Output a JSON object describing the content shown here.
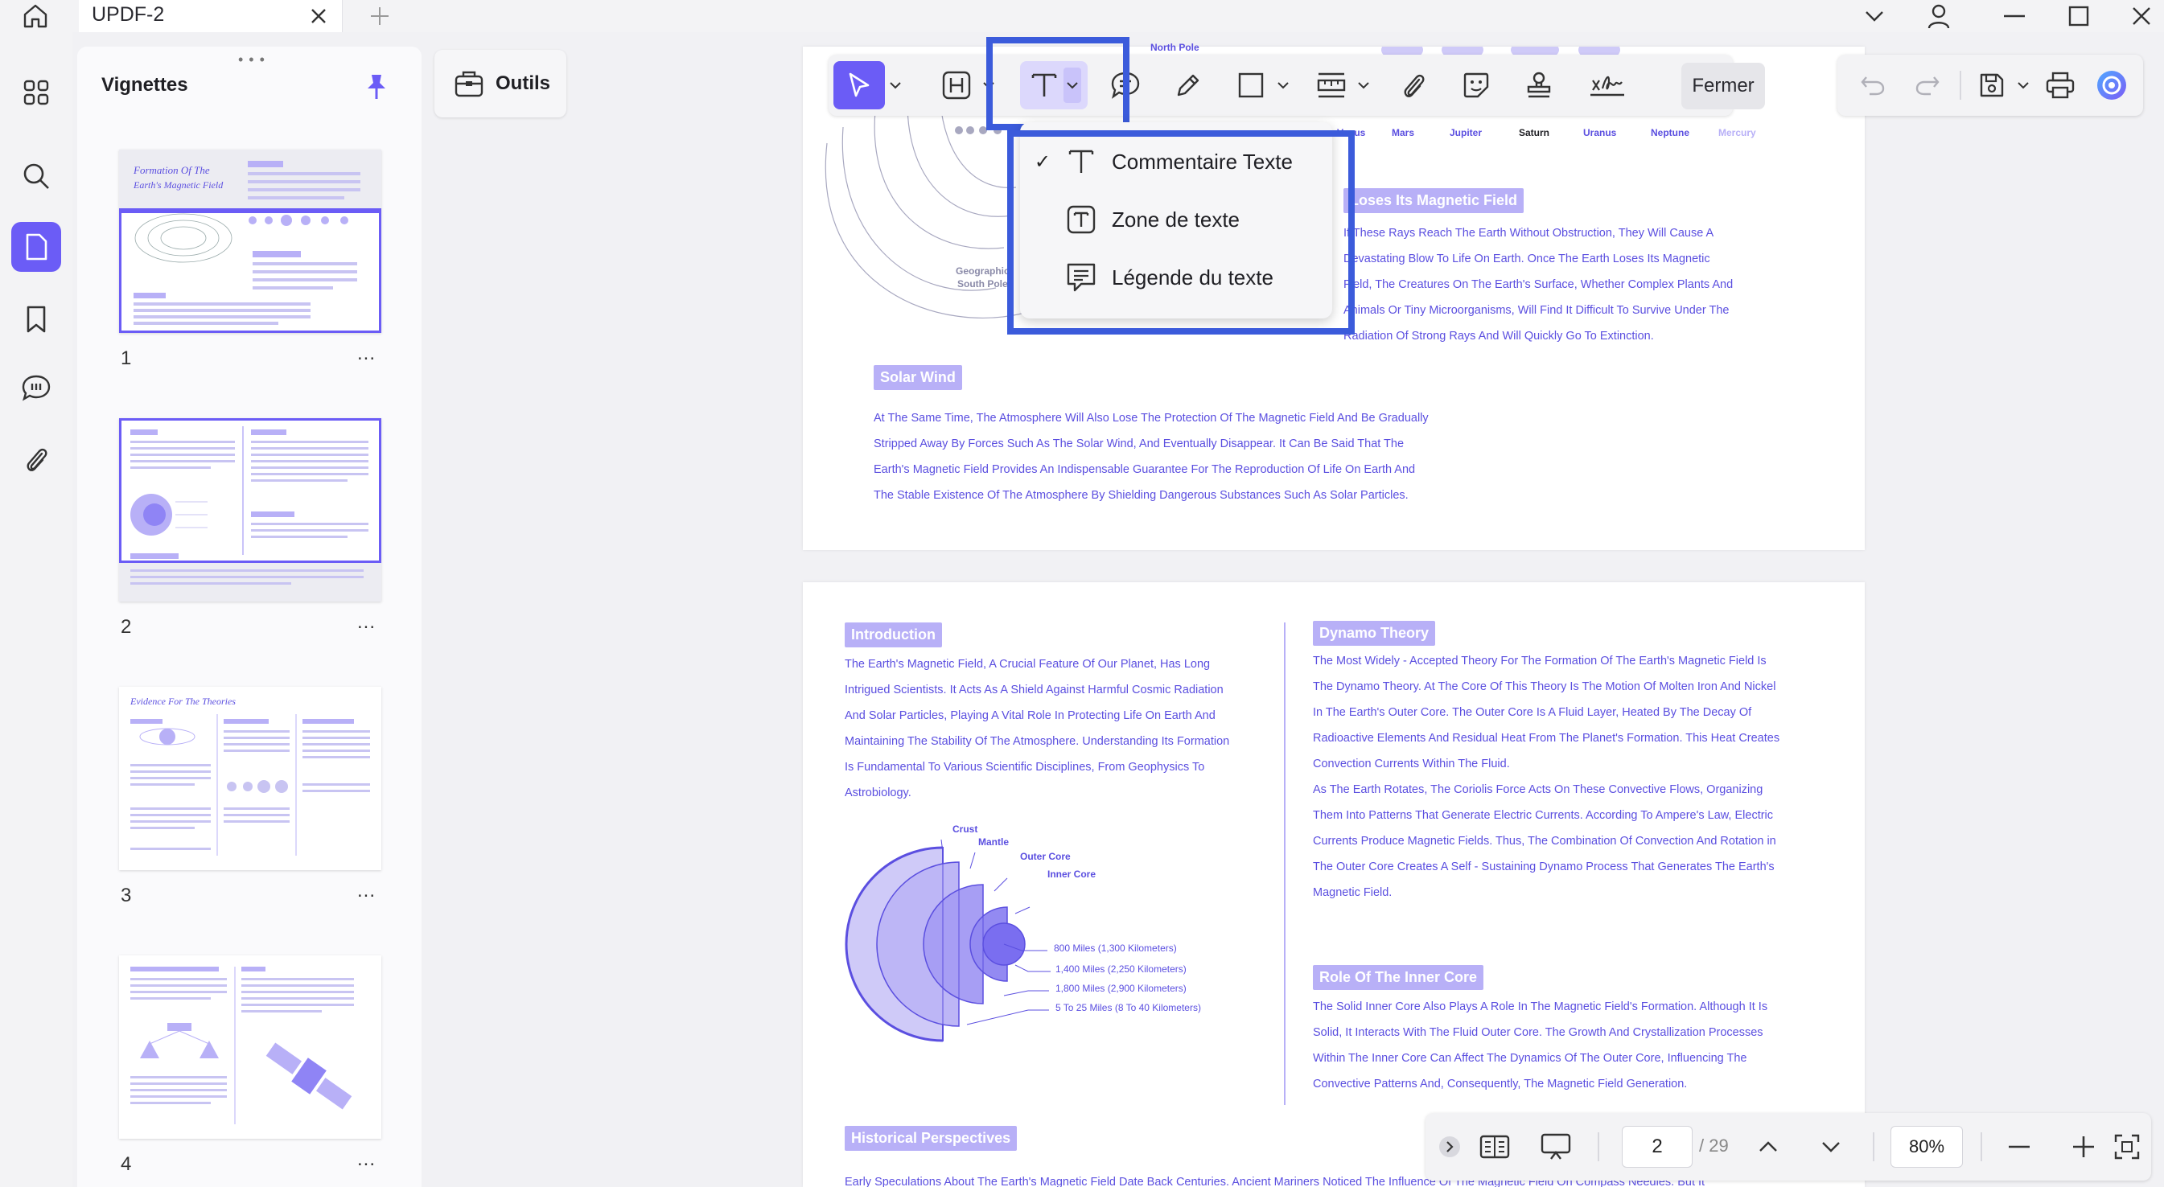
{
  "app": {
    "tab_title": "UPDF-2"
  },
  "thumbnails": {
    "title": "Vignettes",
    "pages": [
      {
        "number": "1",
        "more": "..."
      },
      {
        "number": "2",
        "more": "..."
      },
      {
        "number": "3",
        "more": "..."
      },
      {
        "number": "4",
        "more": "..."
      }
    ]
  },
  "tools_pane": {
    "label": "Outils"
  },
  "toolbar": {
    "close_label": "Fermer"
  },
  "text_dropdown": {
    "items": [
      {
        "label": "Commentaire Texte",
        "checked": "✓"
      },
      {
        "label": "Zone de texte",
        "checked": ""
      },
      {
        "label": "Légende du texte",
        "checked": ""
      }
    ]
  },
  "page1": {
    "north_pole": "North Pole",
    "geographic_south_pole_1": "Geographic",
    "geographic_south_pole_2": "South Pole",
    "planets": [
      "Venus",
      "Mars",
      "Jupiter",
      "Saturn",
      "Uranus",
      "Neptune",
      "Mercury"
    ],
    "loses_field_heading": "Loses Its Magnetic Field",
    "loses_field_lines": [
      "If These Rays Reach The Earth Without Obstruction, They Will Cause A",
      "Devastating Blow To Life On Earth. Once The Earth Loses Its Magnetic",
      "Field, The Creatures On The Earth's Surface, Whether Complex Plants And",
      "Animals Or Tiny Microorganisms, Will Find It Difficult To Survive Under The",
      "Radiation Of Strong Rays And Will Quickly Go To Extinction."
    ],
    "solar_wind_heading": "Solar Wind",
    "solar_wind_lines": [
      "At The Same Time, The Atmosphere Will Also Lose The Protection Of The Magnetic Field And Be Gradually",
      "Stripped Away By Forces Such As The Solar Wind, And Eventually Disappear. It Can Be Said That The",
      "Earth's Magnetic Field Provides An Indispensable Guarantee For The Reproduction Of Life On Earth And",
      "The Stable Existence Of The Atmosphere By Shielding Dangerous Substances Such As Solar Particles."
    ]
  },
  "page2": {
    "introduction_heading": "Introduction",
    "introduction_lines": [
      "The Earth's Magnetic Field, A Crucial Feature Of Our Planet, Has Long",
      "Intrigued Scientists. It Acts As A Shield Against Harmful Cosmic Radiation",
      "And Solar Particles, Playing A Vital Role In Protecting Life On Earth And",
      "Maintaining The Stability Of The Atmosphere. Understanding Its Formation",
      "Is Fundamental To Various Scientific Disciplines, From Geophysics To",
      "Astrobiology."
    ],
    "layers": [
      "Crust",
      "Mantle",
      "Outer Core",
      "Inner Core"
    ],
    "depths": [
      "800 Miles (1,300 Kilometers)",
      "1,400 Miles (2,250 Kilometers)",
      "1,800 Miles (2,900 Kilometers)",
      "5 To 25 Miles (8 To 40 Kilometers)"
    ],
    "dynamo_heading": "Dynamo Theory",
    "dynamo_lines": [
      "The Most Widely - Accepted Theory For The Formation Of The Earth's Magnetic Field Is",
      "The Dynamo Theory. At The Core Of This Theory Is The Motion Of Molten Iron And Nickel",
      "In The Earth's Outer Core. The Outer Core Is A Fluid Layer, Heated By The Decay Of",
      "Radioactive Elements And Residual Heat From The Planet's Formation. This Heat Creates",
      "Convection Currents Within The Fluid.",
      "As The Earth Rotates, The Coriolis Force Acts On These Convective Flows, Organizing",
      "Them Into Patterns That Generate Electric Currents. According To Ampere's Law, Electric",
      "Currents Produce Magnetic Fields. Thus, The Combination Of Convection And Rotation in",
      "The Outer Core Creates A Self - Sustaining Dynamo Process That Generates The Earth's",
      "Magnetic Field."
    ],
    "inner_core_heading": "Role Of The Inner Core",
    "inner_core_lines": [
      "The Solid Inner Core Also Plays A Role In The Magnetic Field's Formation. Although It Is",
      "Solid, It Interacts With The Fluid Outer Core. The Growth And Crystallization Processes",
      "Within The Inner Core Can Affect The Dynamics Of The Outer Core, Influencing The",
      "Convective Patterns And, Consequently, The Magnetic Field Generation."
    ],
    "historical_heading": "Historical Perspectives",
    "historical_line": "Early Speculations About The Earth's Magnetic Field Date Back Centuries. Ancient Mariners Noticed The Influence Of The Magnetic Field On Compass Needles. But It"
  },
  "bottom_bar": {
    "current_page": "2",
    "total_pages": "/ 29",
    "zoom": "80%"
  },
  "colors": {
    "accent": "#6b5cf6",
    "doc_text": "#5b4fe0",
    "pill": "#b8b0f7",
    "highlight_box": "#3b5bdb"
  }
}
